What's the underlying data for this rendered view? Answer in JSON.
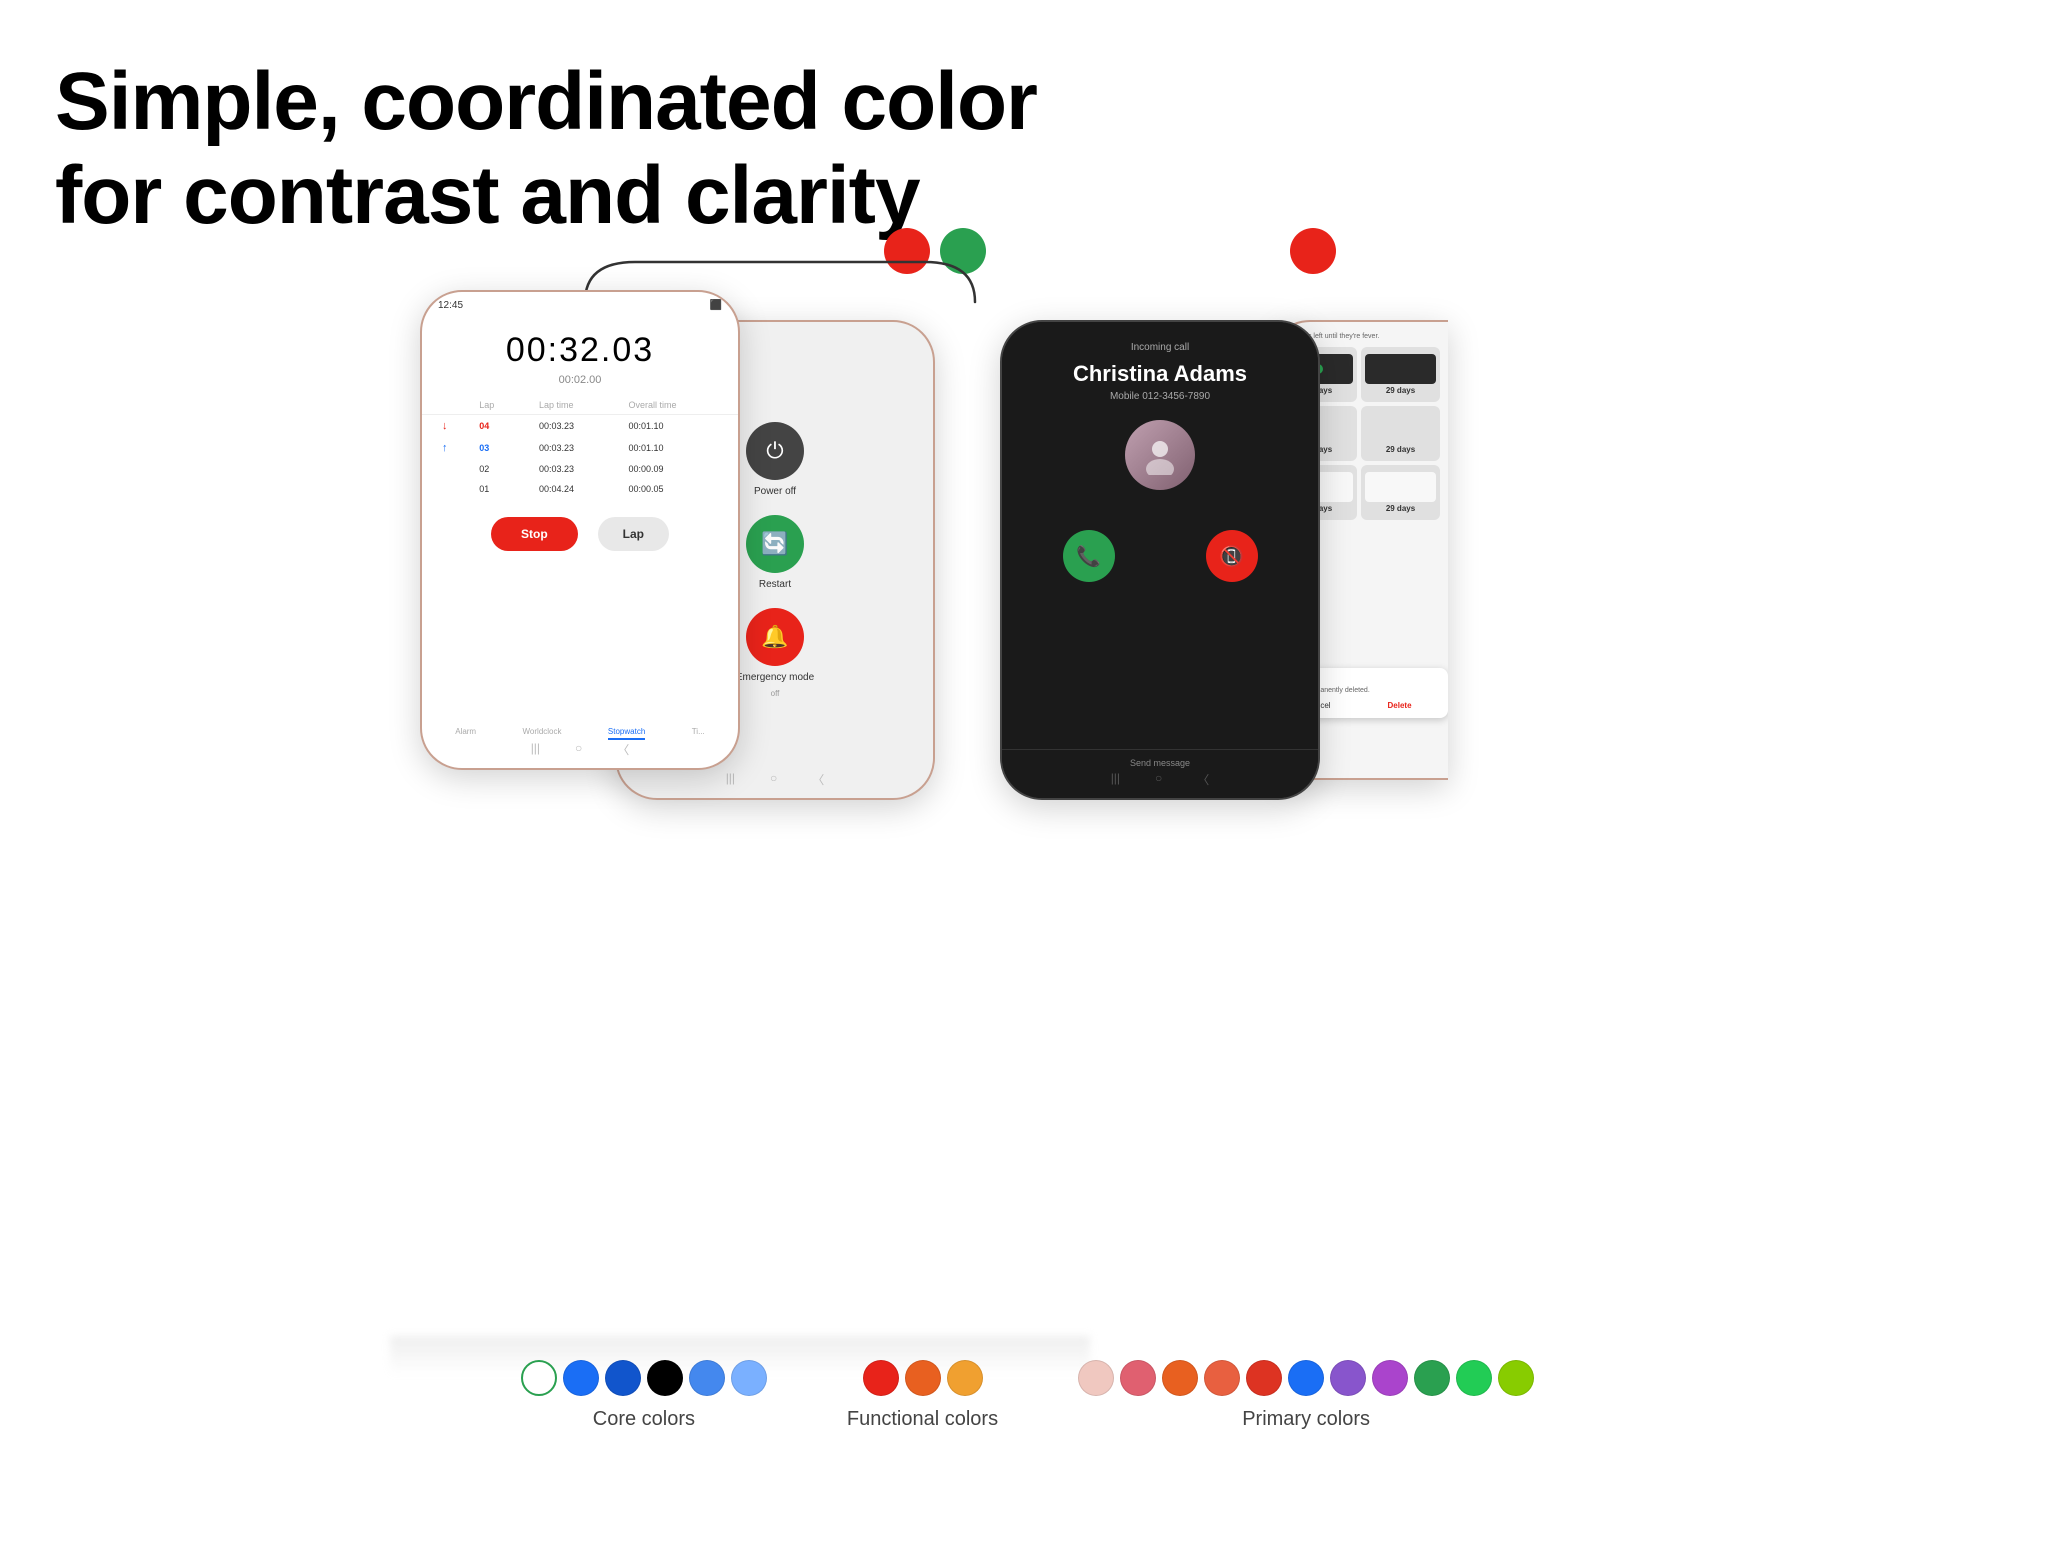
{
  "page": {
    "title_line1": "Simple, coordinated color",
    "title_line2": "for contrast and clarity",
    "background_color": "#ffffff"
  },
  "floating_dots": [
    {
      "color": "#e8231a",
      "label": "red-dot-1"
    },
    {
      "color": "#2aa050",
      "label": "green-dot-1"
    },
    {
      "color": "#e8231a",
      "label": "red-dot-2"
    }
  ],
  "phone1": {
    "time_display": "00:32.03",
    "sub_time": "00:02.00",
    "status_time": "12:45",
    "columns": [
      "Lap",
      "Lap time",
      "Overall time"
    ],
    "rows": [
      {
        "lap": "04",
        "lap_time": "00:03.23",
        "overall": "00:01.10",
        "indicator": "down",
        "color": "red"
      },
      {
        "lap": "03",
        "lap_time": "00:03.23",
        "overall": "00:01.10",
        "indicator": "up",
        "color": "blue"
      },
      {
        "lap": "02",
        "lap_time": "00:03.23",
        "overall": "00:00.09",
        "indicator": "none"
      },
      {
        "lap": "01",
        "lap_time": "00:04.24",
        "overall": "00:00.05",
        "indicator": "none"
      }
    ],
    "btn_stop": "Stop",
    "btn_lap": "Lap",
    "tabs": [
      "Alarm",
      "Worldclock",
      "Stopwatch",
      "Ti..."
    ],
    "active_tab": "Stopwatch"
  },
  "phone2": {
    "items": [
      {
        "label": "Power off",
        "sublabel": "",
        "icon_type": "power",
        "color": "dark"
      },
      {
        "label": "Restart",
        "sublabel": "",
        "icon_type": "restart",
        "color": "green"
      },
      {
        "label": "Emergency mode",
        "sublabel": "off",
        "icon_type": "emergency",
        "color": "red"
      }
    ]
  },
  "phone3": {
    "incoming_label": "Incoming call",
    "name": "Christina Adams",
    "number": "Mobile  012-3456-7890",
    "accept_label": "accept",
    "decline_label": "decline",
    "send_message": "Send message"
  },
  "phone4": {
    "days_label": "29 days",
    "partial": true
  },
  "color_groups": [
    {
      "label": "Core colors",
      "swatches": [
        {
          "color": "#ffffff",
          "border": "#2aa050",
          "type": "outline"
        },
        {
          "color": "#1a6ef5",
          "type": "fill"
        },
        {
          "color": "#1a6ef5",
          "type": "fill"
        },
        {
          "color": "#000000",
          "type": "fill"
        },
        {
          "color": "#1a6ef5",
          "type": "fill"
        },
        {
          "color": "#6699ff",
          "type": "fill"
        }
      ]
    },
    {
      "label": "Functional colors",
      "swatches": [
        {
          "color": "#e8231a",
          "type": "fill"
        },
        {
          "color": "#e86020",
          "type": "fill"
        },
        {
          "color": "#f0a030",
          "type": "fill"
        }
      ]
    },
    {
      "label": "Primary colors",
      "swatches": [
        {
          "color": "#f0c8c0",
          "type": "fill"
        },
        {
          "color": "#e06070",
          "type": "fill"
        },
        {
          "color": "#e86020",
          "type": "fill"
        },
        {
          "color": "#e86040",
          "type": "fill"
        },
        {
          "color": "#e84030",
          "type": "fill"
        },
        {
          "color": "#1a6ef5",
          "type": "fill"
        },
        {
          "color": "#8855cc",
          "type": "fill"
        },
        {
          "color": "#aa44cc",
          "type": "fill"
        },
        {
          "color": "#2aa050",
          "type": "fill"
        },
        {
          "color": "#22cc55",
          "type": "fill"
        },
        {
          "color": "#88cc00",
          "type": "fill"
        }
      ]
    }
  ]
}
